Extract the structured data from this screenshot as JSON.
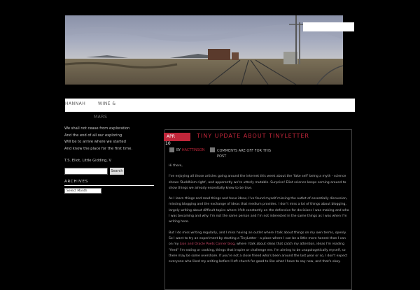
{
  "nav": {
    "item1": "HANNAH",
    "item2": "WINE &",
    "item2_sub": "MARS"
  },
  "sidebar": {
    "quote_lines": [
      "We shall not cease from exploration",
      "And the end of all our exploring",
      "Will be to arrive where we started",
      "And know the place for the first time."
    ],
    "quote_attribution": "T.S. Eliot, Little Gidding, V",
    "search_button": "Search",
    "archives_title": "ARCHIVES",
    "archives_select": "Select Month"
  },
  "post": {
    "month": "APR",
    "day": "10",
    "title": "TINY UPDATE ABOUT TINYLETTER",
    "meta_by": "BY",
    "meta_author": "HACTTINSON",
    "meta_comments": "COMMENTS ARE OFF FOR THIS POST",
    "greeting": "Hi there,",
    "paragraphs": [
      "I've enjoying all those articles going around the internet this week about the 'fake self' being a myth - science shows 'Buddhism right', and apparently we're utterly mutable. Surprise! Eliot science keeps coming around to show things we already essentially knew to be true.",
      "As I learn things and read things and have ideas, I've found myself missing the outlet of essentially discussion, missing blogging and the exchange of ideas that medium provides. I don't miss a lot of things about blogging, largely writing about difficult topics where I felt constantly on the defensive for decisions I was making and who I was becoming and why. I'm not the same person and I'm not interested in the same things as I was when I'm writing here."
    ],
    "para3_a": "But I do miss writing regularly, and I miss having an outlet where I talk about things on my own terms, openly. So I want to try an experiment by starting a TinyLetter - a place where I can be a little more honest than I can on my ",
    "para3_link": "Lion and Oracle",
    "para3_b": " ",
    "para3_link2": "Poets Corner blog",
    "para3_c": ", where I talk about ideas that catch my attention, ideas I'm reading \"feed\" I'm eating or cooking, things that inspire or challenge me. I'm aiming to be unapologetically myself, so there may be some overshare. If you're not a close friend who's been around the last year or so, I don't expect everyone who liked my writing before I left church for good to like what I have to say now, and that's okay."
  }
}
